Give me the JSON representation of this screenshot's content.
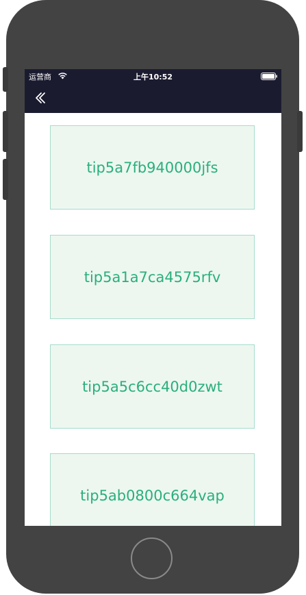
{
  "status_bar": {
    "carrier": "运营商",
    "time": "上午10:52",
    "wifi_icon": "wifi-icon",
    "battery_icon": "battery-icon"
  },
  "nav_bar": {
    "back_icon": "double-chevron-left-icon"
  },
  "tips": [
    {
      "label": "tip5a7fb940000jfs"
    },
    {
      "label": "tip5a1a7ca4575rfv"
    },
    {
      "label": "tip5a5c6cc40d0zwt"
    },
    {
      "label": "tip5ab0800c664vap"
    }
  ],
  "colors": {
    "nav_background": "#1b1b30",
    "card_background": "#edf7f0",
    "card_border": "#a4dccb",
    "card_text": "#2aaf7c",
    "device_body": "#434343"
  }
}
